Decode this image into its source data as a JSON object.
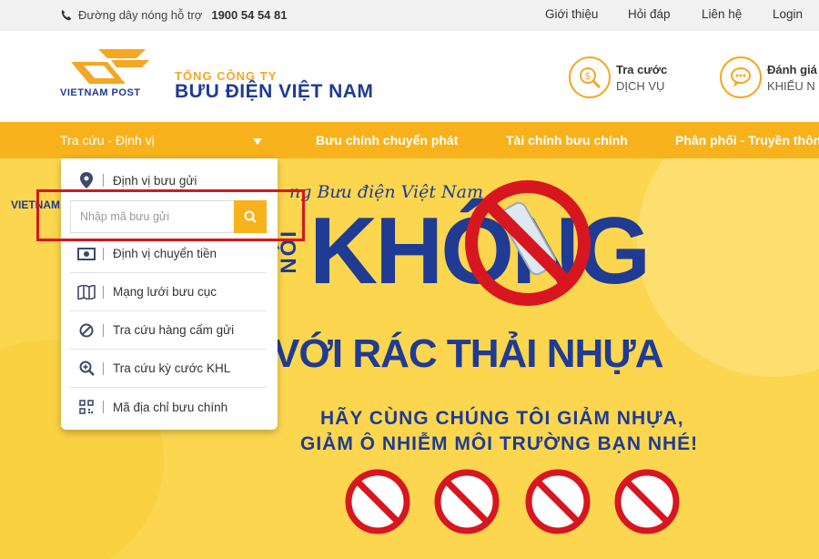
{
  "topbar": {
    "hotline_label": "Đường dây nóng hỗ trợ",
    "hotline_number": "1900 54 54 81",
    "links": [
      "Giới thiệu",
      "Hỏi đáp",
      "Liên hệ",
      "Login"
    ]
  },
  "header": {
    "logo_text": "VIETNAM POST",
    "company_small": "TỔNG CÔNG TY",
    "company_large": "BƯU ĐIỆN VIỆT NAM",
    "services": [
      {
        "title": "Tra cước",
        "subtitle": "DỊCH VỤ",
        "icon": "dollar-search-icon"
      },
      {
        "title": "Đánh giá",
        "subtitle": "KHIẾU N",
        "icon": "chat-bubble-icon"
      }
    ]
  },
  "nav": {
    "items": [
      "Tra cứu - Định vị",
      "Bưu chính chuyển phát",
      "Tài chính bưu chính",
      "Phân phối - Truyền thôn"
    ]
  },
  "dropdown": {
    "first_item": "Định vị bưu gửi",
    "search_placeholder": "Nhập mã bưu gửi",
    "items": [
      {
        "label": "Định vị chuyển tiền",
        "icon": "money-icon"
      },
      {
        "label": "Mạng lưới bưu cục",
        "icon": "map-icon"
      },
      {
        "label": "Tra cứu hàng cấm gửi",
        "icon": "ban-icon"
      },
      {
        "label": "Tra cứu kỳ cước KHL",
        "icon": "zoom-in-icon"
      },
      {
        "label": "Mã địa chỉ bưu chính",
        "icon": "qr-code-icon"
      }
    ]
  },
  "banner": {
    "logo_text": "VIETNAM",
    "line_small": "ng Bưu điện Việt Nam",
    "vertical_word": "NÓI",
    "big_word": "KHÔNG",
    "middle": "VỚI RÁC THẢI NHỰA",
    "sub1": "HÃY CÙNG CHÚNG TÔI GIẢM NHỰA,",
    "sub2": "GIẢM Ô NHIỄM MÔI TRƯỜNG BẠN NHÉ!"
  },
  "colors": {
    "accent": "#f7b21c",
    "brand_blue": "#1f3b93",
    "highlight_red": "#d7161f",
    "banner_yellow": "#fbd64e"
  }
}
